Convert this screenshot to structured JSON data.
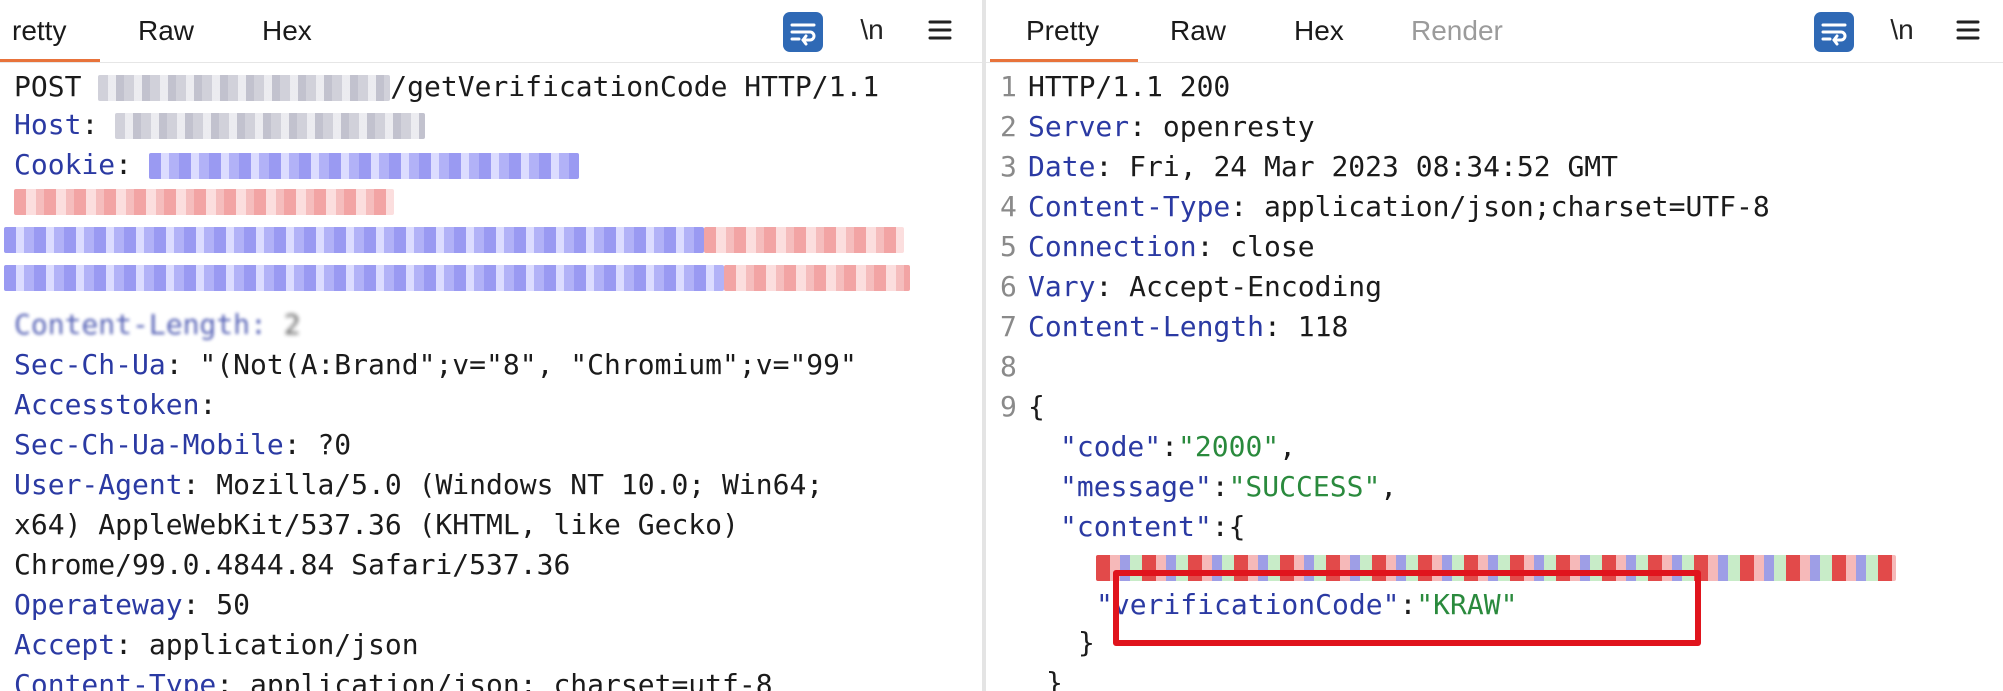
{
  "request": {
    "tabs": [
      {
        "label": "retty"
      },
      {
        "label": "Raw"
      },
      {
        "label": "Hex"
      }
    ],
    "newline_label": "\\n",
    "lines": {
      "request_line_method": "POST ",
      "request_line_path": "/getVerificationCode HTTP/1.1",
      "host_name": "Host",
      "cookie_name": "Cookie",
      "content_length_name": "Content-Length:",
      "content_length_value": "2",
      "sec_ch_ua_name": "Sec-Ch-Ua",
      "sec_ch_ua_value": ": \"(Not(A:Brand\";v=\"8\", \"Chromium\";v=\"99\"",
      "accesstoken_name": "Accesstoken",
      "accesstoken_value": ":",
      "sec_ch_ua_mobile_name": "Sec-Ch-Ua-Mobile",
      "sec_ch_ua_mobile_value": ": ?0",
      "user_agent_name": "User-Agent",
      "user_agent_value": ": Mozilla/5.0 (Windows NT 10.0; Win64;",
      "user_agent_cont1": "x64) AppleWebKit/537.36 (KHTML, like Gecko)",
      "user_agent_cont2": "Chrome/99.0.4844.84 Safari/537.36",
      "operateway_name": "Operateway",
      "operateway_value": ": 50",
      "accept_name": "Accept",
      "accept_value": ": application/json",
      "content_type_name": "Content-Type",
      "content_type_value": ": application/json; charset=utf-8"
    }
  },
  "response": {
    "tabs": [
      {
        "label": "Pretty"
      },
      {
        "label": "Raw"
      },
      {
        "label": "Hex"
      },
      {
        "label": "Render"
      }
    ],
    "newline_label": "\\n",
    "lines": [
      {
        "n": "1",
        "name": "",
        "value": "HTTP/1.1 200"
      },
      {
        "n": "2",
        "name": "Server",
        "value": ": openresty"
      },
      {
        "n": "3",
        "name": "Date",
        "value": ": Fri, 24 Mar 2023 08:34:52 GMT"
      },
      {
        "n": "4",
        "name": "Content-Type",
        "value": ": application/json;charset=UTF-8"
      },
      {
        "n": "5",
        "name": "Connection",
        "value": ": close"
      },
      {
        "n": "6",
        "name": "Vary",
        "value": ": Accept-Encoding"
      },
      {
        "n": "7",
        "name": "Content-Length",
        "value": ": 118"
      },
      {
        "n": "8",
        "name": "",
        "value": ""
      },
      {
        "n": "9",
        "name": "",
        "value": "{"
      }
    ],
    "json": {
      "code_key": "\"code\"",
      "code_value": "\"2000\"",
      "message_key": "\"message\"",
      "message_value": "\"SUCCESS\"",
      "content_key": "\"content\"",
      "verification_key": "\"verificationCode\"",
      "verification_value": "\"KRAW\"",
      "close_inner": "}",
      "close_outer": "}"
    }
  },
  "colors": {
    "accent_underline": "#e8733b",
    "header_name": "#2b3aa3",
    "json_string": "#2a8a3d",
    "highlight_box": "#e0141d",
    "wrap_button": "#2f69b5"
  }
}
